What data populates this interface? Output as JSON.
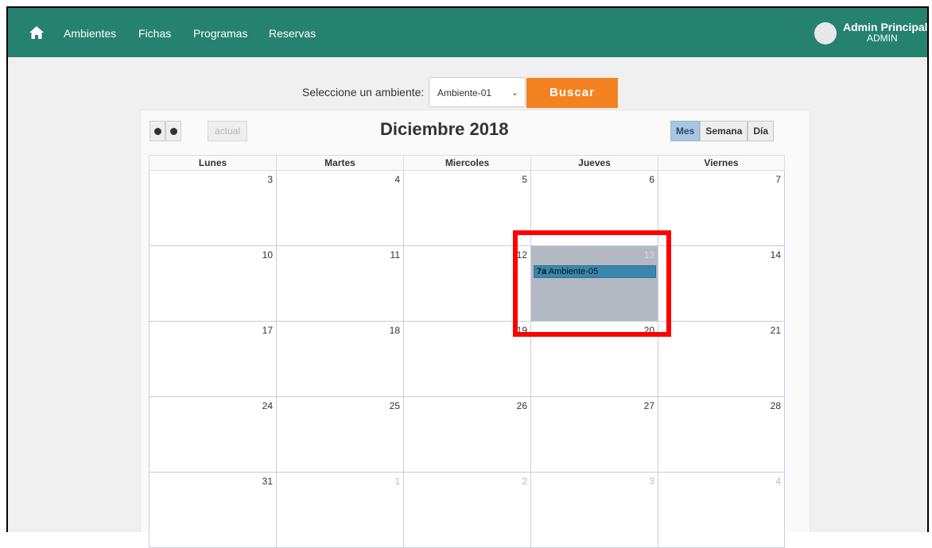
{
  "nav": {
    "links": [
      "Ambientes",
      "Fichas",
      "Programas",
      "Reservas"
    ],
    "user_name": "Admin Principal",
    "user_role": "ADMIN"
  },
  "search": {
    "label": "Seleccione un ambiente:",
    "selected": "Ambiente-01",
    "button": "Buscar"
  },
  "calendar": {
    "actual_label": "actual",
    "title": "Diciembre 2018",
    "views": [
      "Mes",
      "Semana",
      "Día"
    ],
    "active_view": "Mes",
    "weekdays": [
      "Lunes",
      "Martes",
      "Miercoles",
      "Jueves",
      "Viernes"
    ],
    "weeks": [
      [
        {
          "day": "3"
        },
        {
          "day": "4"
        },
        {
          "day": "5"
        },
        {
          "day": "6"
        },
        {
          "day": "7"
        }
      ],
      [
        {
          "day": "10"
        },
        {
          "day": "11"
        },
        {
          "day": "12"
        },
        {
          "day": "13",
          "today": true,
          "event_time": "7a",
          "event_title": "Ambiente-05"
        },
        {
          "day": "14"
        }
      ],
      [
        {
          "day": "17"
        },
        {
          "day": "18"
        },
        {
          "day": "19"
        },
        {
          "day": "20"
        },
        {
          "day": "21"
        }
      ],
      [
        {
          "day": "24"
        },
        {
          "day": "25"
        },
        {
          "day": "26"
        },
        {
          "day": "27"
        },
        {
          "day": "28"
        }
      ],
      [
        {
          "day": "31"
        },
        {
          "day": "1",
          "other": true
        },
        {
          "day": "2",
          "other": true
        },
        {
          "day": "3",
          "other": true
        },
        {
          "day": "4",
          "other": true
        }
      ]
    ]
  },
  "colors": {
    "navbar": "#25826f",
    "buscar": "#f58220",
    "event": "#3a87ad",
    "highlight": "#ff0000"
  }
}
